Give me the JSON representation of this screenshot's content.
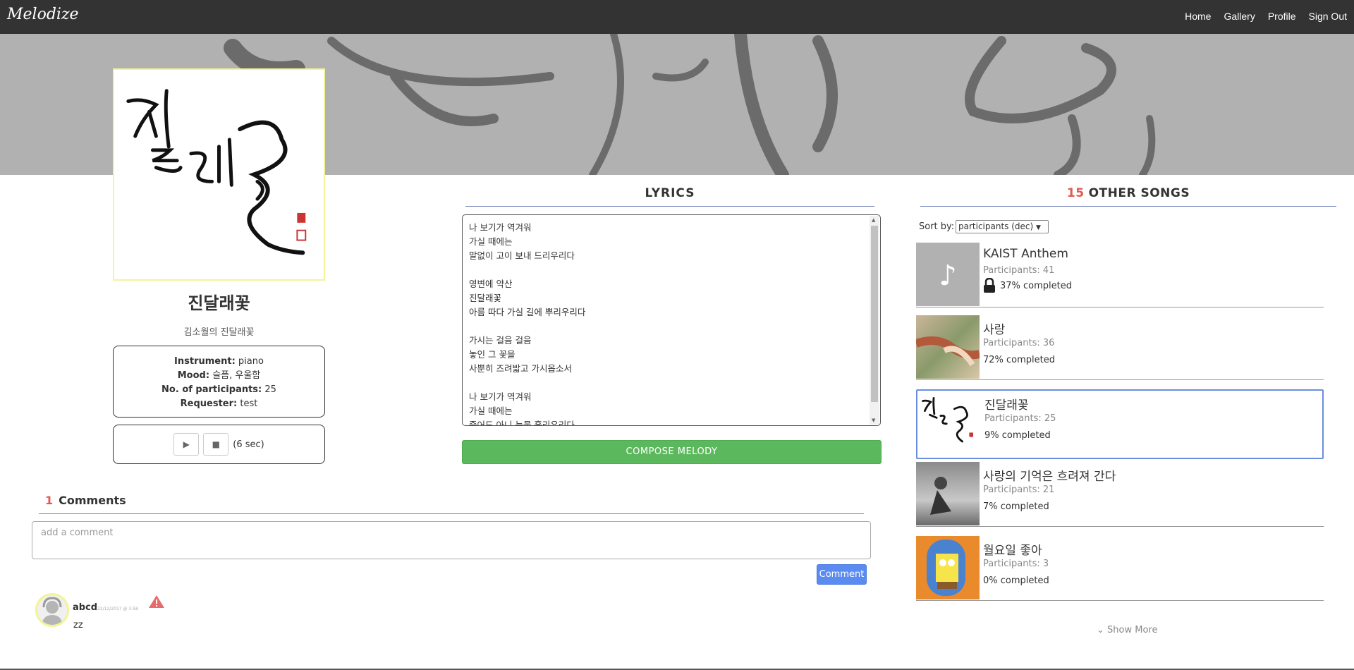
{
  "navbar": {
    "brand": "Melodize",
    "links": [
      "Home",
      "Gallery",
      "Profile",
      "Sign Out"
    ]
  },
  "song": {
    "title": "진달래꽃",
    "subtitle": "김소월의 진달래꽃",
    "instrument_label": "Instrument:",
    "instrument": "piano",
    "mood_label": "Mood:",
    "mood": "슬픔, 우울함",
    "participants_label": "No. of participants:",
    "participants": "25",
    "requester_label": "Requester:",
    "requester": "test",
    "duration": "(6 sec)"
  },
  "lyrics": {
    "heading": "LYRICS",
    "text": "나 보기가 역겨워\n가실 때에는\n말없이 고이 보내 드리우리다\n\n영변에 약산\n진달래꽃\n아름 따다 가실 길에 뿌리우리다\n\n가시는 걸음 걸음\n놓인 그 꽃을\n사뿐히 즈려밟고 가시옵소서\n\n나 보기가 역겨워\n가실 때에는\n죽어도 아니 눈물 흘리우리다",
    "compose_button": "COMPOSE MELODY"
  },
  "other_songs": {
    "count": "15",
    "heading": "OTHER SONGS",
    "sort_label": "Sort by:",
    "sort_value": "participants (dec)",
    "items": [
      {
        "title": "KAIST Anthem",
        "participants": "Participants: 41",
        "completed": "37% completed"
      },
      {
        "title": "사랑",
        "participants": "Participants: 36",
        "completed": "72% completed"
      },
      {
        "title": "진달래꽃",
        "participants": "Participants: 25",
        "completed": "9% completed"
      },
      {
        "title": "사랑의 기억은 흐려져 간다",
        "participants": "Participants: 21",
        "completed": "7% completed"
      },
      {
        "title": "월요일 좋아",
        "participants": "Participants: 3",
        "completed": "0% completed"
      }
    ],
    "show_more": "Show More"
  },
  "comments": {
    "count": "1",
    "heading": "Comments",
    "placeholder": "add a comment",
    "button": "Comment",
    "list": [
      {
        "user": "abcd",
        "date": "22/12/2017 @ 3:58",
        "text": "zz"
      }
    ]
  },
  "colors": {
    "navbar": "#333333",
    "banner": "#b1b1b1",
    "accent_red": "#e05a4e",
    "compose_green": "#5cb85c",
    "comment_blue": "#5b8bf0",
    "active_border": "#6a8ee0"
  }
}
